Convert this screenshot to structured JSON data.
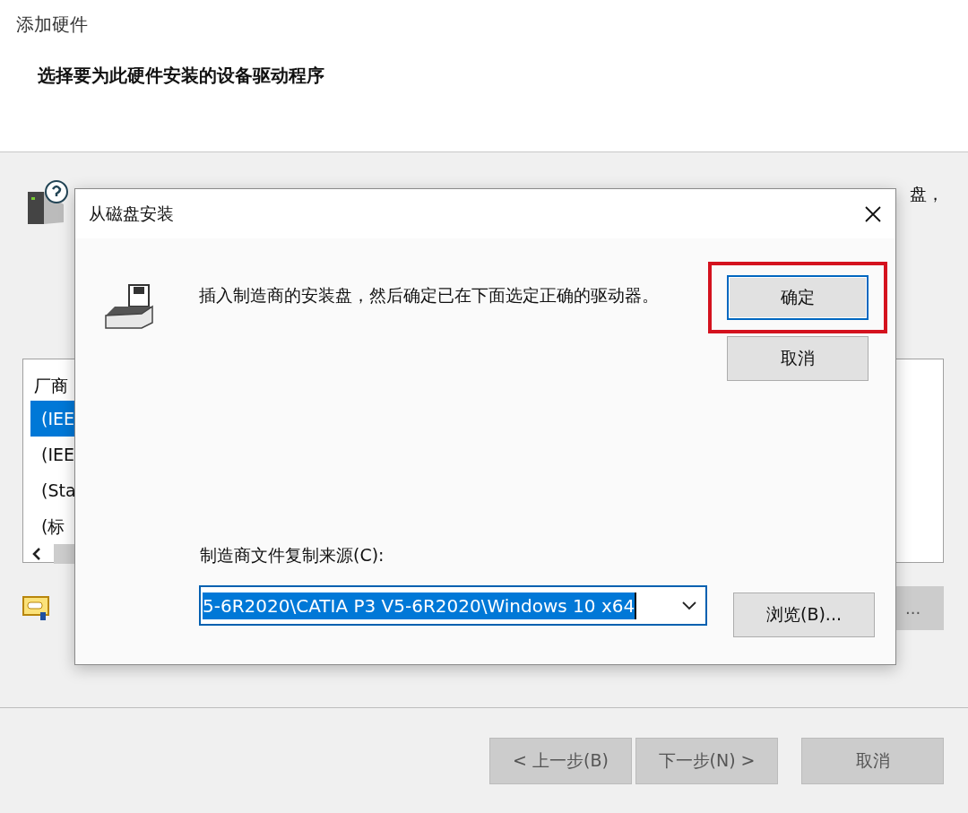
{
  "window": {
    "title": "添加硬件",
    "heading": "选择要为此硬件安装的设备驱动程序",
    "instruction_tail": "盘，"
  },
  "list": {
    "header": "厂商",
    "items": [
      {
        "label": "(IEE",
        "selected": true
      },
      {
        "label": "(IEE",
        "selected": false
      },
      {
        "label": "(Sta",
        "selected": false
      },
      {
        "label": "(标",
        "selected": false
      }
    ]
  },
  "side_button": "...",
  "buttons": [
    {
      "label": "< 上一步(B)"
    },
    {
      "label": "下一步(N) >"
    },
    {
      "label": "取消"
    }
  ],
  "dialog": {
    "title": "从磁盘安装",
    "message": "插入制造商的安装盘，然后确定已在下面选定正确的驱动器。",
    "buttons": [
      {
        "label": "确定",
        "default": true,
        "highlighted": true
      },
      {
        "label": "取消",
        "default": false,
        "highlighted": false
      }
    ],
    "source_label": "制造商文件复制来源(C):",
    "source_value": "5-6R2020\\CATIA P3 V5-6R2020\\Windows 10 x64",
    "browse": "浏览(B)..."
  }
}
